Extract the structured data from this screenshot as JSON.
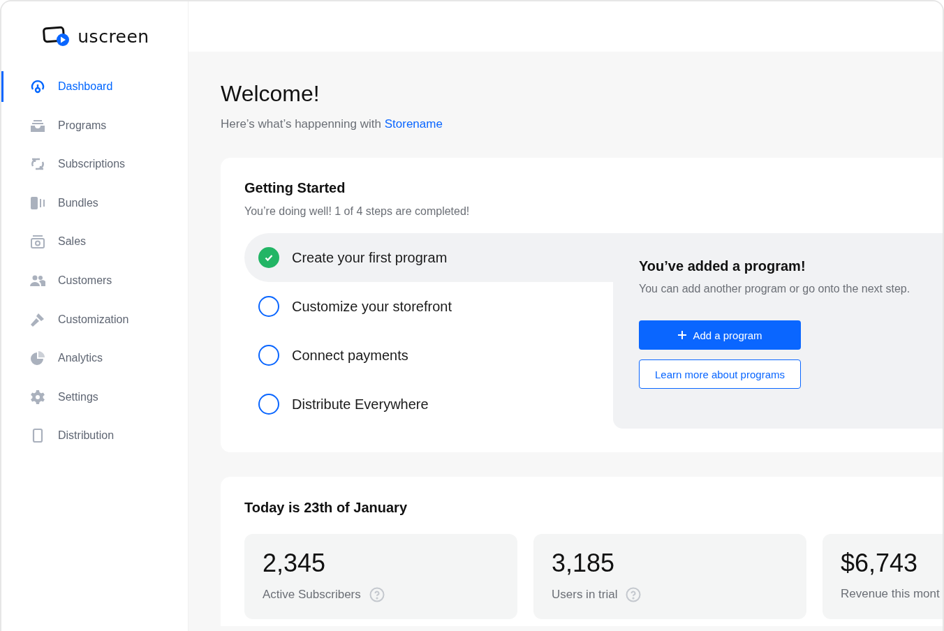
{
  "brand": {
    "name": "uscreen"
  },
  "sidebar": {
    "items": [
      {
        "label": "Dashboard",
        "selected": true
      },
      {
        "label": "Programs",
        "selected": false
      },
      {
        "label": "Subscriptions",
        "selected": false
      },
      {
        "label": "Bundles",
        "selected": false
      },
      {
        "label": "Sales",
        "selected": false
      },
      {
        "label": "Customers",
        "selected": false
      },
      {
        "label": "Customization",
        "selected": false
      },
      {
        "label": "Analytics",
        "selected": false
      },
      {
        "label": "Settings",
        "selected": false
      },
      {
        "label": "Distribution",
        "selected": false
      }
    ]
  },
  "welcome": {
    "title": "Welcome!",
    "subtitle": "Here’s what’s happenning with",
    "store_link": "Storename"
  },
  "getting_started": {
    "title": "Getting Started",
    "progress": "You’re doing well! 1 of 4 steps are completed!",
    "steps": [
      {
        "label": "Create your first program",
        "done": true,
        "selected": true
      },
      {
        "label": "Customize your storefront",
        "done": false,
        "selected": false
      },
      {
        "label": "Connect payments",
        "done": false,
        "selected": false
      },
      {
        "label": "Distribute Everywhere",
        "done": false,
        "selected": false
      }
    ],
    "detail": {
      "title": "You’ve added a program!",
      "text": "You can add another program or go onto the next step.",
      "primary_button": "Add a program",
      "secondary_button": "Learn more about programs"
    }
  },
  "today": {
    "title": "Today is 23th of January",
    "stats": [
      {
        "value": "2,345",
        "label": "Active Subscribers",
        "help": true
      },
      {
        "value": "3,185",
        "label": "Users in trial",
        "help": true
      },
      {
        "value": "$6,743",
        "label": "Revenue this mont",
        "help": false
      }
    ]
  }
}
